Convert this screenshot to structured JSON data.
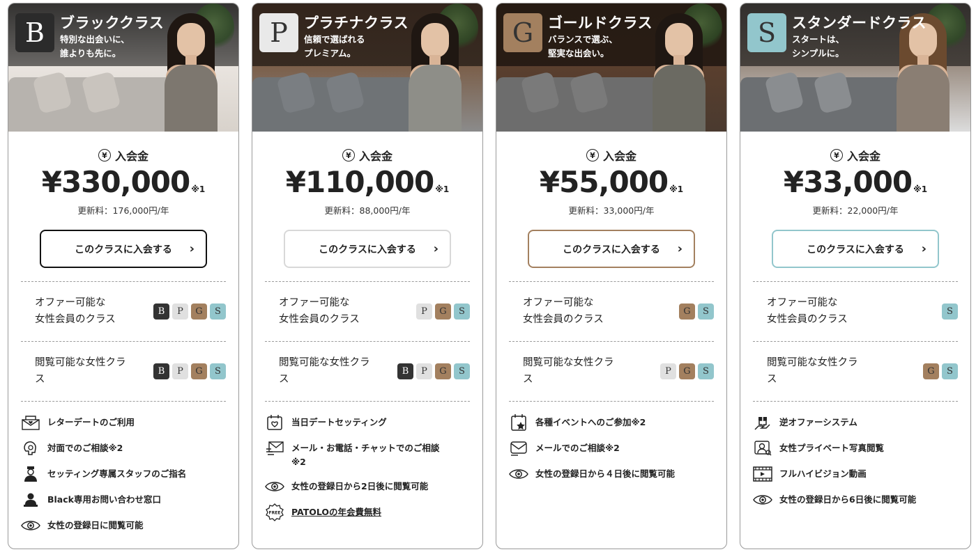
{
  "colors": {
    "black": "#333333",
    "platinum": "#e0e0e0",
    "gold": "#a3805f",
    "standard": "#92c6cc"
  },
  "plans": [
    {
      "letter": "B",
      "title": "ブラッククラス",
      "subtitle_line1": "特別な出会いに、",
      "subtitle_line2": "誰よりも先に。",
      "fee_label": "入会金",
      "yen_symbol": "¥",
      "amount": "¥330,000",
      "amount_note": "※1",
      "renewal": "更新料：176,000円/年",
      "button_label": "このクラスに入会する",
      "offer_label_line1": "オファー可能な",
      "offer_label_line2": "女性会員のクラス",
      "offer_badges": [
        "B",
        "P",
        "G",
        "S"
      ],
      "view_label_line1": "閲覧可能な女性クラ",
      "view_label_line2": "ス",
      "view_badges": [
        "B",
        "P",
        "G",
        "S"
      ],
      "features": [
        {
          "icon": "letter-icon",
          "text": "レターデートのご利用"
        },
        {
          "icon": "headset-icon",
          "text": "対面でのご相談※2"
        },
        {
          "icon": "staff-icon",
          "text": "セッティング専属スタッフのご指名"
        },
        {
          "icon": "concierge-icon",
          "text": "Black専用お問い合わせ窓口"
        },
        {
          "icon": "eye-icon",
          "text": "女性の登録日に閲覧可能"
        }
      ]
    },
    {
      "letter": "P",
      "title": "プラチナクラス",
      "subtitle_line1": "信頼で選ばれる",
      "subtitle_line2": "プレミアム。",
      "fee_label": "入会金",
      "yen_symbol": "¥",
      "amount": "¥110,000",
      "amount_note": "※1",
      "renewal": "更新料：88,000円/年",
      "button_label": "このクラスに入会する",
      "offer_label_line1": "オファー可能な",
      "offer_label_line2": "女性会員のクラス",
      "offer_badges": [
        "P",
        "G",
        "S"
      ],
      "view_label_line1": "閲覧可能な女性クラ",
      "view_label_line2": "ス",
      "view_badges": [
        "B",
        "P",
        "G",
        "S"
      ],
      "features": [
        {
          "icon": "calendar-heart-icon",
          "text": "当日デートセッティング"
        },
        {
          "icon": "mail-chat-icon",
          "text": "メール・お電話・チャットでのご相談",
          "text2": "※2"
        },
        {
          "icon": "eye-icon",
          "text": "女性の登録日から2日後に閲覧可能"
        },
        {
          "icon": "free-icon",
          "text": "PATOLOの年会費無料"
        }
      ]
    },
    {
      "letter": "G",
      "title": "ゴールドクラス",
      "subtitle_line1": "バランスで選ぶ、",
      "subtitle_line2": "堅実な出会い。",
      "fee_label": "入会金",
      "yen_symbol": "¥",
      "amount": "¥55,000",
      "amount_note": "※1",
      "renewal": "更新料：33,000円/年",
      "button_label": "このクラスに入会する",
      "offer_label_line1": "オファー可能な",
      "offer_label_line2": "女性会員のクラス",
      "offer_badges": [
        "G",
        "S"
      ],
      "view_label_line1": "閲覧可能な女性クラ",
      "view_label_line2": "ス",
      "view_badges": [
        "P",
        "G",
        "S"
      ],
      "features": [
        {
          "icon": "calendar-star-icon",
          "text": "各種イベントへのご参加※2"
        },
        {
          "icon": "mail-icon",
          "text": "メールでのご相談※2"
        },
        {
          "icon": "eye-icon",
          "text": "女性の登録日から４日後に閲覧可能"
        }
      ]
    },
    {
      "letter": "S",
      "title": "スタンダードクラス",
      "subtitle_line1": "スタートは、",
      "subtitle_line2": "シンプルに。",
      "fee_label": "入会金",
      "yen_symbol": "¥",
      "amount": "¥33,000",
      "amount_note": "※1",
      "renewal": "更新料：22,000円/年",
      "button_label": "このクラスに入会する",
      "offer_label_line1": "オファー可能な",
      "offer_label_line2": "女性会員のクラス",
      "offer_badges": [
        "S"
      ],
      "view_label_line1": "閲覧可能な女性クラ",
      "view_label_line2": "ス",
      "view_badges": [
        "G",
        "S"
      ],
      "features": [
        {
          "icon": "gift-icon",
          "text": "逆オファーシステム"
        },
        {
          "icon": "photo-person-icon",
          "text": "女性プライベート写真閲覧"
        },
        {
          "icon": "video-icon",
          "text": "フルハイビジョン動画"
        },
        {
          "icon": "eye-icon",
          "text": "女性の登録日から6日後に閲覧可能"
        }
      ]
    }
  ],
  "chevron": "›"
}
